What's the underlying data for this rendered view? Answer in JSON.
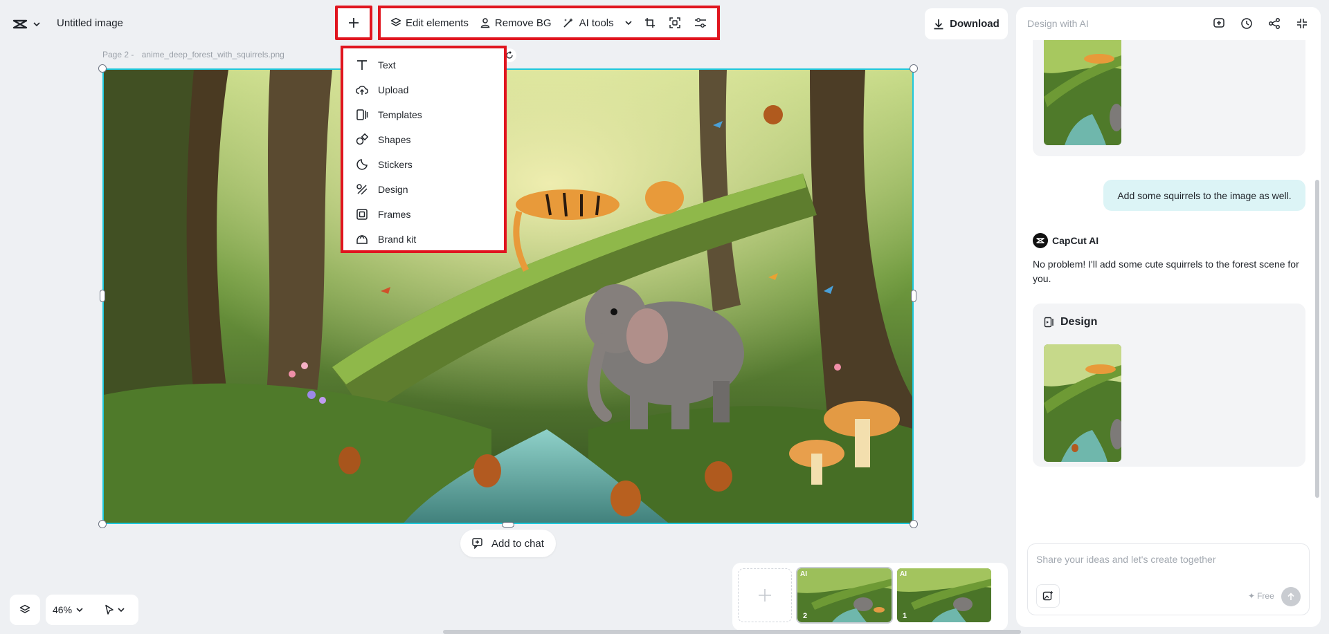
{
  "header": {
    "title": "Untitled image",
    "download_label": "Download"
  },
  "toolbar": {
    "edit_elements": "Edit elements",
    "remove_bg": "Remove BG",
    "ai_tools": "AI tools"
  },
  "canvas": {
    "page_label": "Page 2 -",
    "file_name": "anime_deep_forest_with_squirrels.png",
    "add_to_chat": "Add to chat"
  },
  "add_menu": {
    "items": [
      {
        "label": "Text",
        "icon": "text-icon"
      },
      {
        "label": "Upload",
        "icon": "upload-icon"
      },
      {
        "label": "Templates",
        "icon": "templates-icon"
      },
      {
        "label": "Shapes",
        "icon": "shapes-icon"
      },
      {
        "label": "Stickers",
        "icon": "stickers-icon"
      },
      {
        "label": "Design",
        "icon": "design-icon"
      },
      {
        "label": "Frames",
        "icon": "frames-icon"
      },
      {
        "label": "Brand kit",
        "icon": "brand-kit-icon"
      }
    ]
  },
  "bottom": {
    "zoom": "46%"
  },
  "filmstrip": {
    "pages": [
      {
        "badge": "AI",
        "number": "2"
      },
      {
        "badge": "AI",
        "number": "1"
      }
    ]
  },
  "panel": {
    "title": "Design with AI",
    "user_message": "Add some squirrels to the image as well.",
    "ai_name": "CapCut AI",
    "ai_message": "No problem! I'll add some cute squirrels to the forest scene for you.",
    "design_card_title": "Design",
    "composer_placeholder": "Share your ideas and let's create together",
    "free_label": "Free"
  },
  "colors": {
    "highlight": "#e0151f",
    "selection": "#1ec8dc",
    "user_bubble": "#dcf4f6"
  }
}
